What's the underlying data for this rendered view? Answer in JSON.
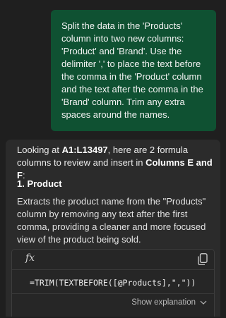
{
  "user_message": {
    "text": "Split the data in the 'Products' column into two new columns: 'Product' and 'Brand'. Use the delimiter ',' to place the text before the comma in the 'Product' column and the text after the comma in the 'Brand' column. Trim any extra spaces around the names."
  },
  "assistant": {
    "intro_prefix": "Looking at ",
    "intro_range": "A1:L13497",
    "intro_middle": ", here are 2 formula columns to review and insert in ",
    "intro_columns": "Columns E and F",
    "intro_suffix": ":",
    "section_title": "1. Product",
    "section_description": "Extracts the product name from the \"Products\" column by removing any text after the first comma, providing a cleaner and more focused view of the product being sold.",
    "formula": {
      "icon": "fx-icon",
      "copy_icon": "copy-icon",
      "text": "=TRIM(TEXTBEFORE([@Products],\",\"))",
      "explain_label": "Show explanation",
      "explain_icon": "chevron-down-icon"
    }
  },
  "colors": {
    "background": "#1f1f1f",
    "user_bubble": "#0f5132",
    "assistant_card": "#2b2b2b"
  }
}
